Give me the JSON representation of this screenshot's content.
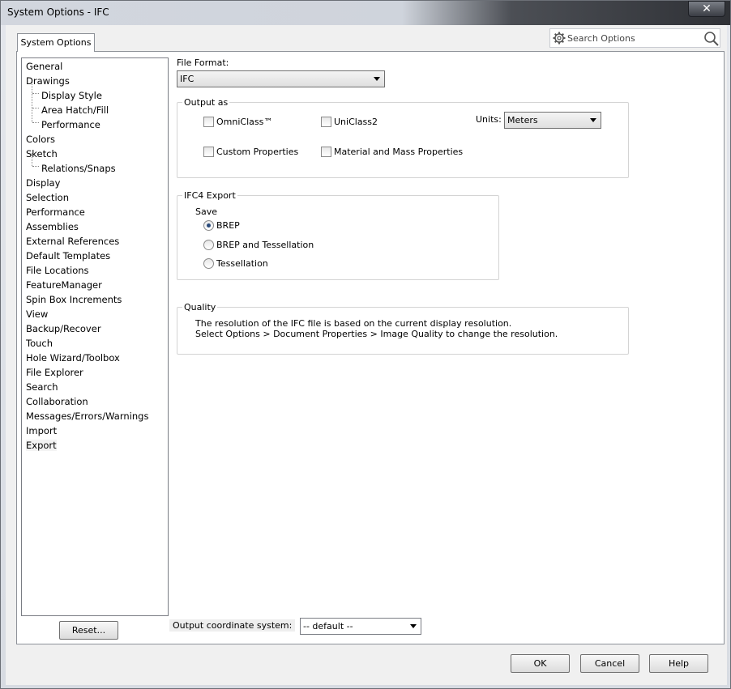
{
  "window": {
    "title": "System Options - IFC",
    "close_glyph": "✕"
  },
  "tab": {
    "label": "System Options"
  },
  "search": {
    "placeholder": "Search Options"
  },
  "sidebar": {
    "items": [
      {
        "label": "General",
        "level": 0
      },
      {
        "label": "Drawings",
        "level": 0
      },
      {
        "label": "Display Style",
        "level": 1
      },
      {
        "label": "Area Hatch/Fill",
        "level": 1
      },
      {
        "label": "Performance",
        "level": 1
      },
      {
        "label": "Colors",
        "level": 0
      },
      {
        "label": "Sketch",
        "level": 0
      },
      {
        "label": "Relations/Snaps",
        "level": 1
      },
      {
        "label": "Display",
        "level": 0
      },
      {
        "label": "Selection",
        "level": 0
      },
      {
        "label": "Performance",
        "level": 0
      },
      {
        "label": "Assemblies",
        "level": 0
      },
      {
        "label": "External References",
        "level": 0
      },
      {
        "label": "Default Templates",
        "level": 0
      },
      {
        "label": "File Locations",
        "level": 0
      },
      {
        "label": "FeatureManager",
        "level": 0
      },
      {
        "label": "Spin Box Increments",
        "level": 0
      },
      {
        "label": "View",
        "level": 0
      },
      {
        "label": "Backup/Recover",
        "level": 0
      },
      {
        "label": "Touch",
        "level": 0
      },
      {
        "label": "Hole Wizard/Toolbox",
        "level": 0
      },
      {
        "label": "File Explorer",
        "level": 0
      },
      {
        "label": "Search",
        "level": 0
      },
      {
        "label": "Collaboration",
        "level": 0
      },
      {
        "label": "Messages/Errors/Warnings",
        "level": 0
      },
      {
        "label": "Import",
        "level": 0
      },
      {
        "label": "Export",
        "level": 0,
        "selected": true
      }
    ],
    "reset_label": "Reset..."
  },
  "main": {
    "file_format_label": "File Format:",
    "file_format_value": "IFC",
    "output_as": {
      "title": "Output as",
      "omniclass": "OmniClass™",
      "uniclass": "UniClass2",
      "custom_properties": "Custom Properties",
      "material_mass": "Material and Mass Properties",
      "units_label": "Units:",
      "units_value": "Meters"
    },
    "ifc4": {
      "title": "IFC4 Export",
      "save_label": "Save",
      "options": [
        "BREP",
        "BREP and Tessellation",
        "Tessellation"
      ],
      "selected": "BREP"
    },
    "quality": {
      "title": "Quality",
      "line1": "The resolution of the IFC file is based on the current display resolution.",
      "line2": "Select Options > Document Properties > Image Quality to change the resolution."
    },
    "coord_label": "Output coordinate system:",
    "coord_value": "-- default --"
  },
  "footer": {
    "ok": "OK",
    "cancel": "Cancel",
    "help": "Help"
  }
}
